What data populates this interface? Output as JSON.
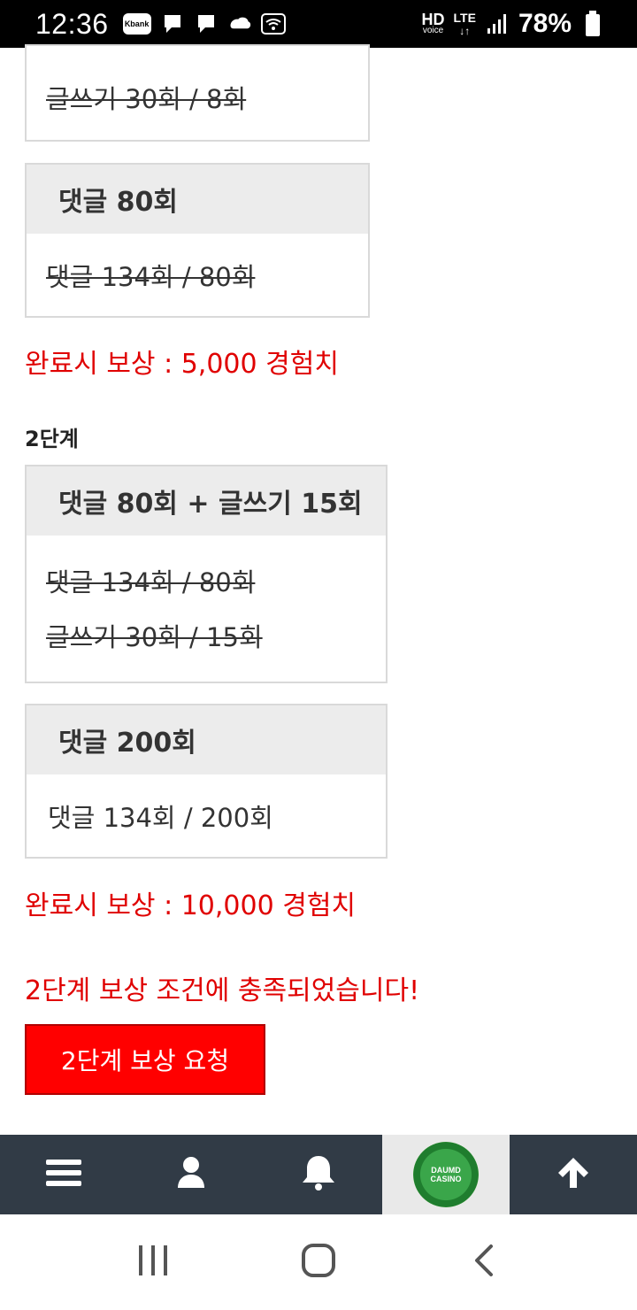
{
  "status_bar": {
    "time": "12:36",
    "kbank": "Kbank",
    "hd": "HD",
    "hd_sub": "voice",
    "lte": "LTE",
    "battery": "78%"
  },
  "stage1": {
    "partial_card_line": "글쓰기 30회 / 8회",
    "card2_title": "댓글 80회",
    "card2_line": "댓글 134회 / 80회",
    "reward": "완료시 보상 : 5,000 경험치"
  },
  "stage2": {
    "label": "2단계",
    "card1_title": "댓글 80회 + 글쓰기 15회",
    "card1_line1": "댓글 134회 / 80회",
    "card1_line2": "글쓰기 30회 / 15회",
    "card2_title": "댓글 200회",
    "card2_line": "댓글 134회 / 200회",
    "reward": "완료시 보상 : 10,000 경험치",
    "notice": "2단계 보상 조건에 충족되었습니다!",
    "request_button": "2단계 보상 요청"
  },
  "app_nav": {
    "logo_line1": "DAUMD",
    "logo_line2": "CASINO"
  },
  "icons": {
    "menu": "menu-icon",
    "user": "user-icon",
    "bell": "bell-icon",
    "up": "arrow-up-icon"
  },
  "colors": {
    "accent_red": "#e00000",
    "button_red": "#ff0000",
    "nav_bg": "#313b46"
  }
}
